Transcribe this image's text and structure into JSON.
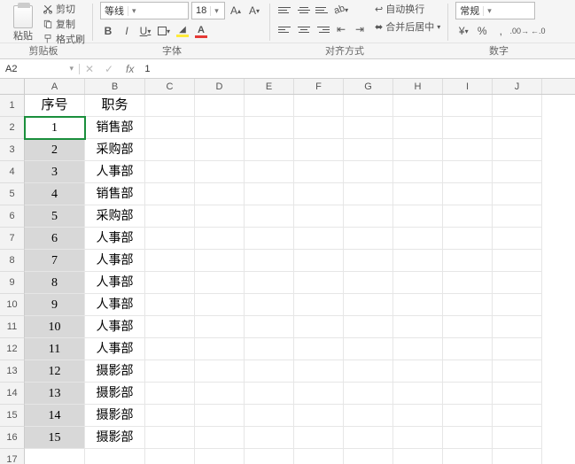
{
  "ribbon": {
    "clipboard": {
      "paste": "粘贴",
      "cut": "剪切",
      "copy": "复制",
      "painter": "格式刷",
      "label": "剪贴板"
    },
    "font": {
      "name": "等线",
      "size": "18",
      "label": "字体"
    },
    "alignment": {
      "wrap": "自动换行",
      "merge": "合并后居中",
      "label": "对齐方式"
    },
    "number": {
      "format": "常规",
      "label": "数字"
    }
  },
  "cellref": {
    "name": "A2",
    "formula": "1"
  },
  "columns": [
    "A",
    "B",
    "C",
    "D",
    "E",
    "F",
    "G",
    "H",
    "I",
    "J"
  ],
  "sheet": {
    "header": {
      "A": "序号",
      "B": "职务"
    },
    "rows": [
      {
        "n": 1,
        "a": "1",
        "b": "销售部"
      },
      {
        "n": 2,
        "a": "2",
        "b": "采购部"
      },
      {
        "n": 3,
        "a": "3",
        "b": "人事部"
      },
      {
        "n": 4,
        "a": "4",
        "b": "销售部"
      },
      {
        "n": 5,
        "a": "5",
        "b": "采购部"
      },
      {
        "n": 6,
        "a": "6",
        "b": "人事部"
      },
      {
        "n": 7,
        "a": "7",
        "b": "人事部"
      },
      {
        "n": 8,
        "a": "8",
        "b": "人事部"
      },
      {
        "n": 9,
        "a": "9",
        "b": "人事部"
      },
      {
        "n": 10,
        "a": "10",
        "b": "人事部"
      },
      {
        "n": 11,
        "a": "11",
        "b": "人事部"
      },
      {
        "n": 12,
        "a": "12",
        "b": "摄影部"
      },
      {
        "n": 13,
        "a": "13",
        "b": "摄影部"
      },
      {
        "n": 14,
        "a": "14",
        "b": "摄影部"
      },
      {
        "n": 15,
        "a": "15",
        "b": "摄影部"
      }
    ]
  },
  "selection": {
    "col": "A",
    "from_row": 2,
    "to_row": 16,
    "active_row": 2
  }
}
